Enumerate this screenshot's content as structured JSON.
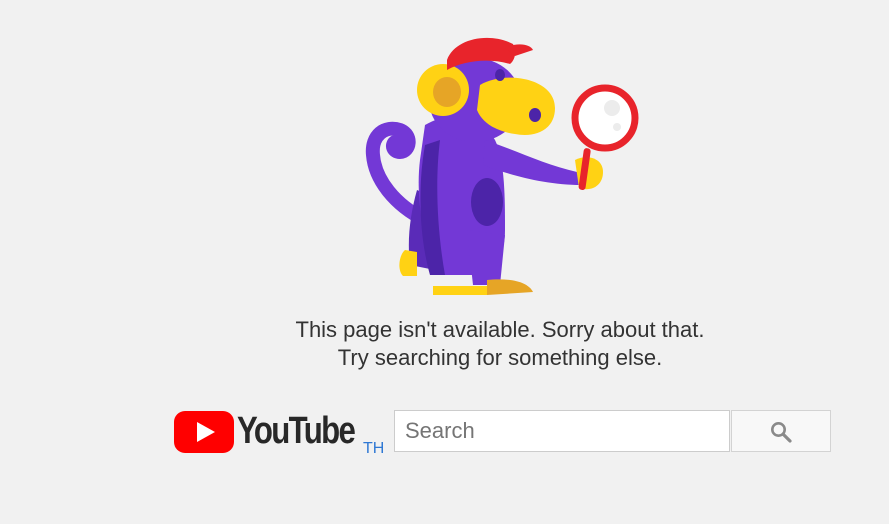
{
  "error": {
    "line1": "This page isn't available. Sorry about that.",
    "line2": "Try searching for something else."
  },
  "brand": {
    "wordmark": "YouTube",
    "country_code": "TH",
    "logo_icon": "youtube-play-icon",
    "red": "#ff0000"
  },
  "search": {
    "placeholder": "Search",
    "value": "",
    "button_icon": "search-icon"
  },
  "colors": {
    "background": "#f1f1f1",
    "monkey_purple": "#7338d6",
    "monkey_yellow": "#ffd214",
    "hat_red": "#e8242b",
    "country_blue": "#2f78d4"
  }
}
